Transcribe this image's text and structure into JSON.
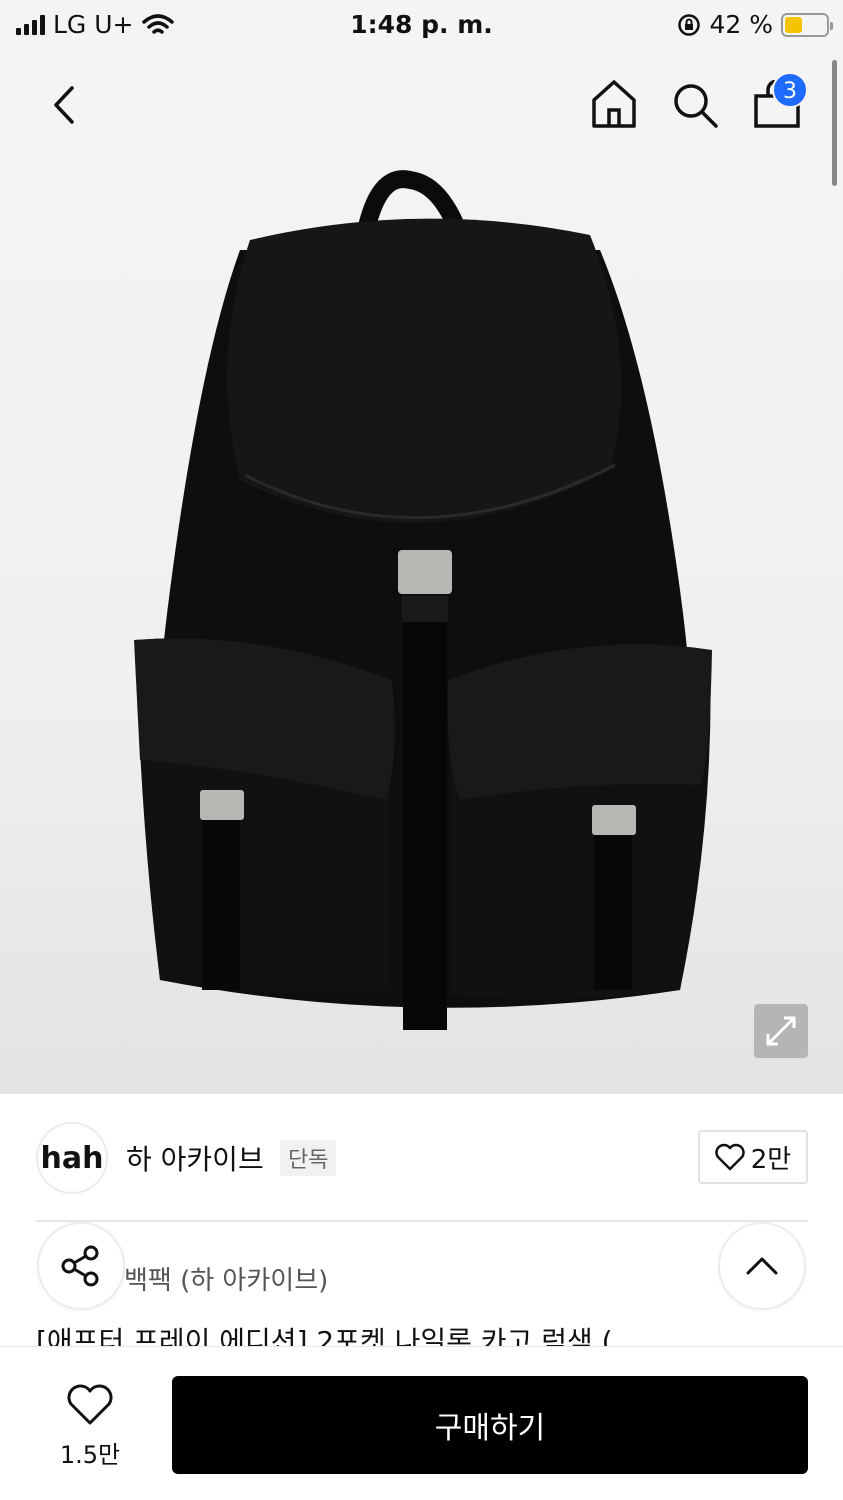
{
  "status_bar": {
    "carrier": "LG U+",
    "time": "1:48 p. m.",
    "battery_percent": "42 %",
    "battery_level": 0.42,
    "battery_color": "#f5c400"
  },
  "nav": {
    "back_icon": "chevron-left",
    "home_icon": "home",
    "search_icon": "search",
    "bag_icon": "shopping-bag",
    "cart_count": "3",
    "badge_color": "#1f6bff"
  },
  "product_image": {
    "expand_icon": "expand-arrows"
  },
  "brand": {
    "logo_text": "hah",
    "name": "하 아카이브",
    "exclusive_label": "단독",
    "like_count": "2만"
  },
  "product": {
    "category": "백팩 (하 아카이브)",
    "title": "[애프터 프레이 에디션] 2포켓 나일론 카고 럭색 ("
  },
  "bottom_bar": {
    "wish_count": "1.5만",
    "buy_label": "구매하기",
    "buy_color": "#000000"
  }
}
